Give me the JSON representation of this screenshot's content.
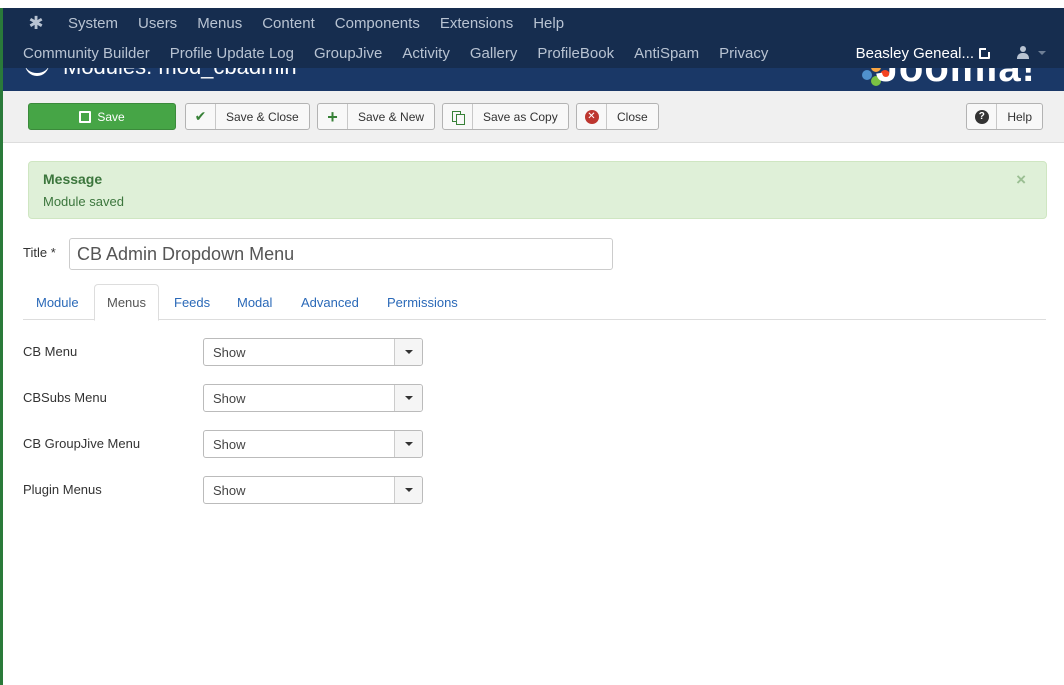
{
  "nav": {
    "row1": [
      "System",
      "Users",
      "Menus",
      "Content",
      "Components",
      "Extensions",
      "Help"
    ],
    "row2": [
      "Community Builder",
      "Profile Update Log",
      "GroupJive",
      "Activity",
      "Gallery",
      "ProfileBook",
      "AntiSpam",
      "Privacy"
    ],
    "site_link": "Beasley Geneal...",
    "logo_icon": "joomla-logo-icon"
  },
  "header": {
    "page_title": "Modules: mod_cbadmin",
    "brand": "Joomla!"
  },
  "toolbar": {
    "save": "Save",
    "save_close": "Save & Close",
    "save_new": "Save & New",
    "save_copy": "Save as Copy",
    "close": "Close",
    "help": "Help"
  },
  "message": {
    "heading": "Message",
    "text": "Module saved",
    "close": "×"
  },
  "form": {
    "title_label": "Title *",
    "title_value": "CB Admin Dropdown Menu"
  },
  "tabs": [
    "Module",
    "Menus",
    "Feeds",
    "Modal",
    "Advanced",
    "Permissions"
  ],
  "active_tab": "Menus",
  "fields": [
    {
      "label": "CB Menu",
      "value": "Show"
    },
    {
      "label": "CBSubs Menu",
      "value": "Show"
    },
    {
      "label": "CB GroupJive Menu",
      "value": "Show"
    },
    {
      "label": "Plugin Menus",
      "value": "Show"
    }
  ],
  "colors": {
    "navbar": "#162d4f",
    "header": "#1a3867",
    "save_button": "#46a546",
    "message_bg": "#dff0d8",
    "link": "#2a69b8"
  }
}
